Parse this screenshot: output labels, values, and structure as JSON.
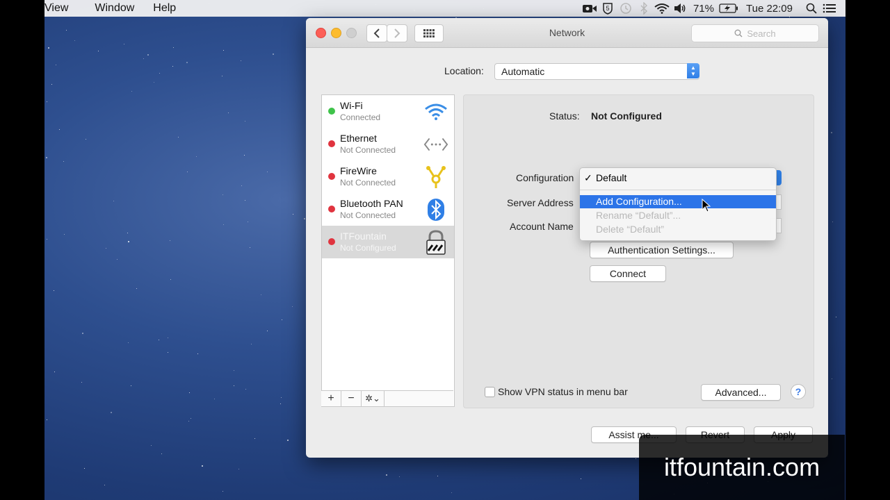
{
  "menubar": {
    "items": [
      "View",
      "Window",
      "Help"
    ],
    "battery": "71%",
    "clock": "Tue 22:09"
  },
  "window": {
    "title": "Network",
    "search_placeholder": "Search",
    "location_label": "Location:",
    "location_value": "Automatic"
  },
  "services": [
    {
      "name": "Wi-Fi",
      "status": "Connected",
      "color": "#3fc34a",
      "icon": "wifi-icon"
    },
    {
      "name": "Ethernet",
      "status": "Not Connected",
      "color": "#e0343f",
      "icon": "ethernet-icon"
    },
    {
      "name": "FireWire",
      "status": "Not Connected",
      "color": "#e0343f",
      "icon": "firewire-icon"
    },
    {
      "name": "Bluetooth PAN",
      "status": "Not Connected",
      "color": "#e0343f",
      "icon": "bluetooth-icon"
    },
    {
      "name": "ITFountain",
      "status": "Not Configured",
      "color": "#e0343f",
      "icon": "vpn-lock-icon"
    }
  ],
  "list_bar": {
    "add": "+",
    "remove": "−",
    "gear": "✲⌄"
  },
  "detail": {
    "status_label": "Status:",
    "status_value": "Not Configured",
    "configuration_label": "Configuration",
    "server_address_label": "Server Address",
    "account_name_label": "Account Name",
    "auth_button": "Authentication Settings...",
    "connect_button": "Connect",
    "show_vpn_label": "Show VPN status in menu bar",
    "advanced_button": "Advanced...",
    "help_button": "?"
  },
  "dropdown": {
    "checkmark": "✓",
    "items": [
      "Default",
      "Add Configuration...",
      "Rename “Default”...",
      "Delete “Default”"
    ]
  },
  "footer": {
    "assist_button": "Assist me...",
    "revert_button": "Revert",
    "apply_button": "Apply"
  },
  "watermark": "itfountain.com"
}
